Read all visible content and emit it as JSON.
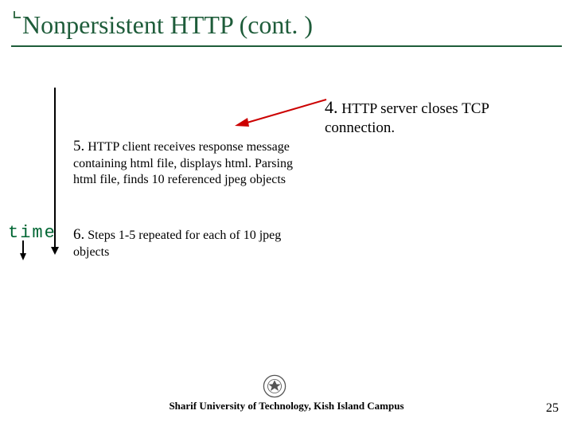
{
  "title": "Nonpersistent HTTP (cont. )",
  "time_label": "time",
  "steps": {
    "s4": {
      "num": "4.",
      "text_a": "HTTP ",
      "text_b": "server closes TCP connection."
    },
    "s5": {
      "num": "5.",
      "text": "HTTP client receives response message containing html file, displays html.  Parsing html file, finds 10 referenced jpeg  objects"
    },
    "s6": {
      "num": "6.",
      "text": "Steps 1-5 repeated for each of 10 jpeg objects"
    }
  },
  "footer": "Sharif University of Technology, Kish Island Campus",
  "page_number": "25"
}
